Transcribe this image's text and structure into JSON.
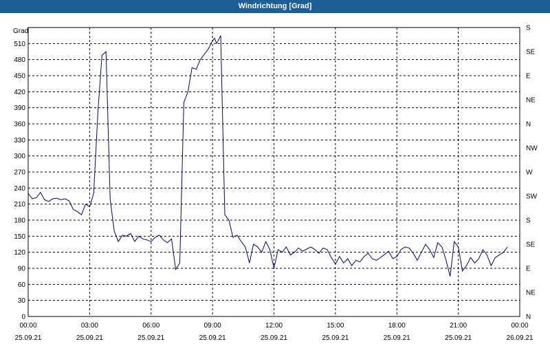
{
  "window": {
    "title": "Windrichtung [Grad]"
  },
  "chart_data": {
    "type": "line",
    "title": "Windrichtung [Grad]",
    "ylabel": "Grad",
    "ylim": [
      0,
      540
    ],
    "y_ticks": [
      0,
      30,
      60,
      90,
      120,
      150,
      180,
      210,
      240,
      270,
      300,
      330,
      360,
      390,
      420,
      450,
      480,
      510
    ],
    "right_axis_labels": [
      "N",
      "NE",
      "E",
      "SE",
      "S",
      "SW",
      "W",
      "NW",
      "N",
      "NE",
      "E",
      "SE",
      "S"
    ],
    "x_ticks": [
      {
        "time": "00:00",
        "date": "25.09.21"
      },
      {
        "time": "03:00",
        "date": "25.09.21"
      },
      {
        "time": "06:00",
        "date": "25.09.21"
      },
      {
        "time": "09:00",
        "date": "25.09.21"
      },
      {
        "time": "12:00",
        "date": "25.09.21"
      },
      {
        "time": "15:00",
        "date": "25.09.21"
      },
      {
        "time": "18:00",
        "date": "25.09.21"
      },
      {
        "time": "21:00",
        "date": "25.09.21"
      },
      {
        "time": "00:00",
        "date": "26.09.21"
      }
    ],
    "xlim_hours": [
      0,
      24
    ],
    "grid": true,
    "line_color": "#00008b",
    "series": [
      {
        "x_hours": [
          0,
          0.2,
          0.4,
          0.6,
          0.8,
          1,
          1.2,
          1.4,
          1.6,
          1.8,
          2,
          2.2,
          2.4,
          2.6,
          2.8,
          3,
          3.2,
          3.4,
          3.6,
          3.8,
          4,
          4.2,
          4.4,
          4.6,
          4.8,
          5,
          5.2,
          5.4,
          5.6,
          5.8,
          6,
          6.2,
          6.4,
          6.6,
          6.8,
          7,
          7.2,
          7.4,
          7.6,
          7.8,
          8,
          8.2,
          8.4,
          8.6,
          8.8,
          9,
          9.1,
          9.2,
          9.4,
          9.6,
          9.8,
          10,
          10.2,
          10.4,
          10.6,
          10.8,
          11,
          11.2,
          11.4,
          11.6,
          11.8,
          12,
          12.2,
          12.4,
          12.6,
          12.8,
          13,
          13.2,
          13.4,
          13.6,
          13.8,
          14,
          14.2,
          14.4,
          14.6,
          14.8,
          15,
          15.2,
          15.4,
          15.6,
          15.8,
          16,
          16.2,
          16.4,
          16.6,
          16.8,
          17,
          17.2,
          17.4,
          17.6,
          17.8,
          18,
          18.2,
          18.4,
          18.6,
          18.8,
          19,
          19.2,
          19.4,
          19.6,
          19.8,
          20,
          20.2,
          20.4,
          20.6,
          20.8,
          21,
          21.2,
          21.4,
          21.6,
          21.8,
          22,
          22.2,
          22.4,
          22.6,
          22.8,
          23,
          23.2,
          23.4,
          23.6,
          23.8,
          24
        ],
        "values": [
          230,
          220,
          222,
          232,
          218,
          215,
          220,
          221,
          218,
          220,
          216,
          200,
          196,
          190,
          210,
          205,
          230,
          380,
          488,
          495,
          220,
          160,
          140,
          152,
          150,
          155,
          140,
          150,
          145,
          143,
          140,
          148,
          152,
          143,
          138,
          145,
          88,
          100,
          400,
          420,
          465,
          462,
          480,
          490,
          500,
          515,
          520,
          510,
          525,
          190,
          180,
          148,
          152,
          140,
          130,
          100,
          135,
          130,
          120,
          140,
          125,
          90,
          125,
          120,
          130,
          115,
          120,
          128,
          122,
          126,
          130,
          125,
          118,
          128,
          125,
          110,
          98,
          112,
          100,
          108,
          95,
          105,
          102,
          112,
          118,
          108,
          105,
          110,
          116,
          122,
          108,
          112,
          125,
          130,
          128,
          118,
          105,
          120,
          135,
          125,
          110,
          138,
          130,
          105,
          75,
          140,
          130,
          85,
          95,
          110,
          100,
          108,
          125,
          115,
          95,
          110,
          115,
          120,
          130
        ]
      }
    ]
  }
}
